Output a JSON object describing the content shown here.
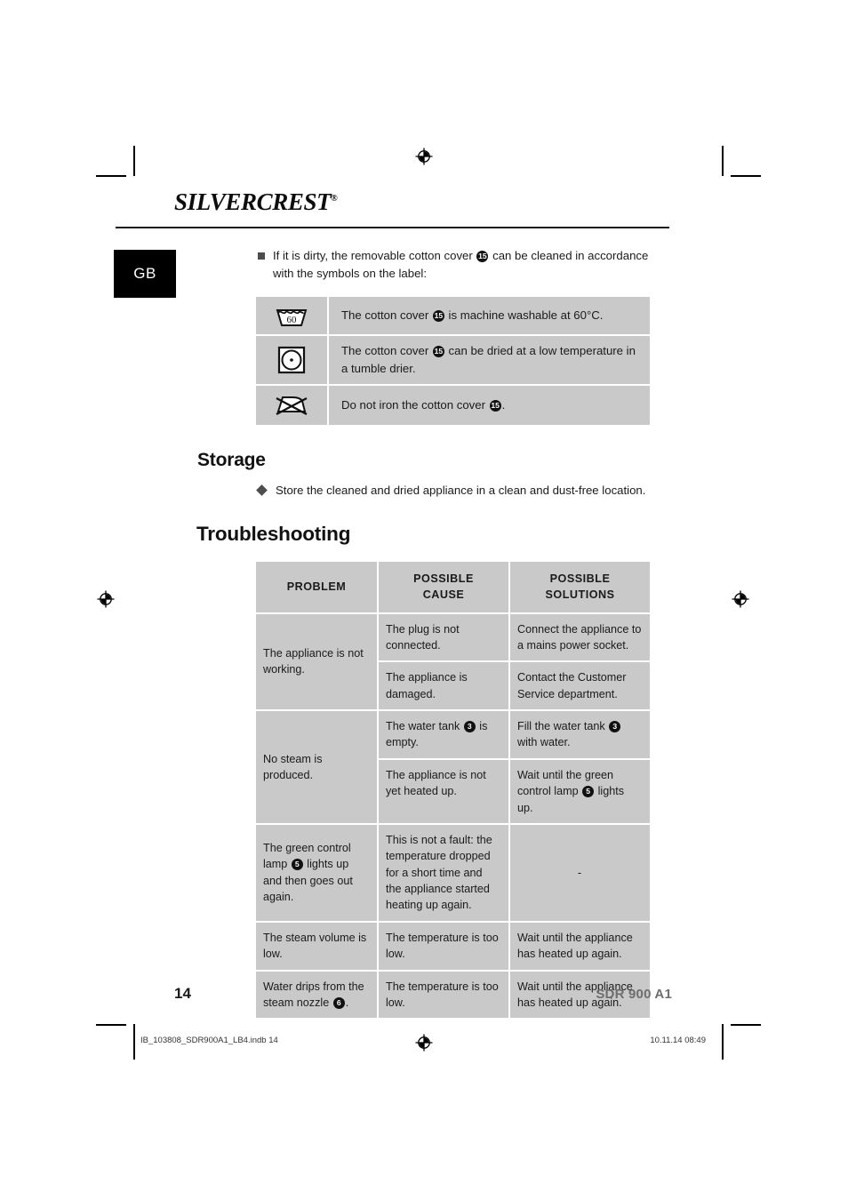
{
  "page": {
    "brand": "SILVERCREST",
    "brand_registered": "®",
    "language_tag": "GB",
    "page_number": "14",
    "model": "SDR 900 A1",
    "print_file": "IB_103808_SDR900A1_LB4.indb   14",
    "print_date": "10.11.14   08:49",
    "accent_gray": "#c9c9c9",
    "text_color": "#1a1a1a",
    "tab_background": "#000000"
  },
  "intro": {
    "bullet_icon": "square-bullet-icon",
    "text_before": "If it is dirty, the removable cotton cover ",
    "badge": "15",
    "text_after": " can be cleaned in accordance with the symbols on the label:"
  },
  "care_table": {
    "rows": [
      {
        "icon": "wash-tub-60-icon",
        "icon_label": "60",
        "text_before": "The cotton cover ",
        "badge": "15",
        "text_after": " is machine washable at 60°C."
      },
      {
        "icon": "tumble-dry-low-icon",
        "icon_label": "",
        "text_before": "The cotton cover ",
        "badge": "15",
        "text_after": " can be dried at a low temperature in a tumble drier."
      },
      {
        "icon": "do-not-iron-icon",
        "icon_label": "",
        "text_before": "Do not iron the cotton cover ",
        "badge": "15",
        "text_after": "."
      }
    ]
  },
  "storage": {
    "heading": "Storage",
    "bullet_icon": "diamond-bullet-icon",
    "bullet": "Store the cleaned and dried appliance in a clean and dust-free location."
  },
  "troubleshooting": {
    "heading": "Troubleshooting",
    "headers": {
      "problem": "PROBLEM",
      "cause_line1": "POSSIBLE",
      "cause_line2": "CAUSE",
      "solution_line1": "POSSIBLE",
      "solution_line2": "SOLUTIONS"
    },
    "rows": [
      {
        "problem": "The appliance is not working.",
        "subrows": [
          {
            "cause": "The plug is not connected.",
            "solution": "Connect the appliance to a mains power socket."
          },
          {
            "cause": "The appliance is damaged.",
            "solution": "Contact the Customer Service department."
          }
        ]
      },
      {
        "problem": "No steam is produced.",
        "subrows": [
          {
            "cause_before": "The water tank ",
            "cause_badge": "3",
            "cause_after": " is empty.",
            "solution_before": "Fill the water tank ",
            "solution_badge": "3",
            "solution_after": " with water."
          },
          {
            "cause_before": "The appliance is not yet heated up.",
            "cause_badge": "",
            "cause_after": "",
            "solution_before": "Wait until the green control lamp ",
            "solution_badge": "5",
            "solution_after": " lights up."
          }
        ]
      },
      {
        "problem_before": "The green control lamp ",
        "problem_badge": "5",
        "problem_after": " lights up and then goes out again.",
        "cause": "This is not a fault: the temperature dropped for a short time and the appliance started heating up again.",
        "solution": "-"
      },
      {
        "problem": "The steam volume is low.",
        "cause": "The temperature is too low.",
        "solution": "Wait until the appliance has heated up again."
      },
      {
        "problem_before": "Water drips from the steam nozzle ",
        "problem_badge": "6",
        "problem_after": ".",
        "cause": "The temperature is too low.",
        "solution": "Wait until the appliance has heated up again."
      }
    ]
  }
}
